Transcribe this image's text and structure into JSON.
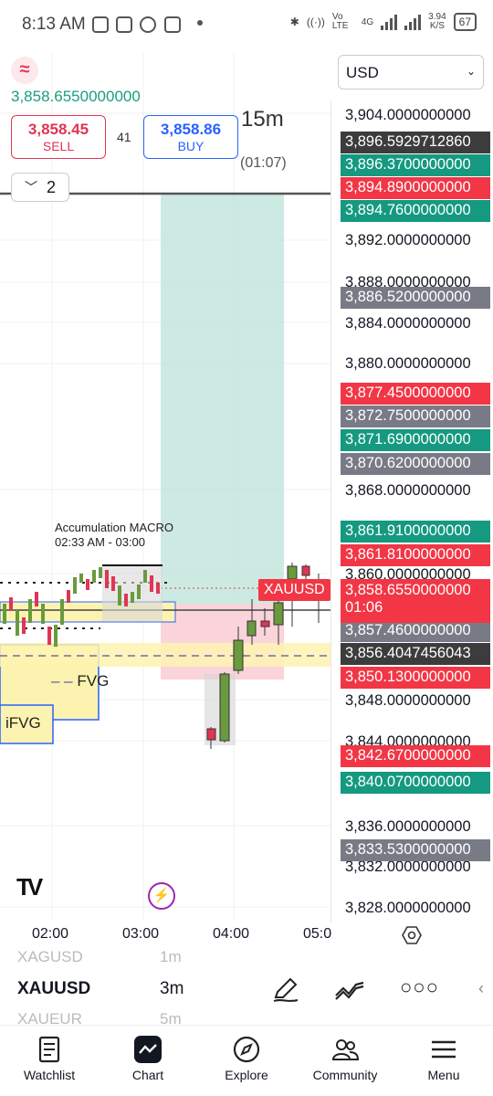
{
  "status_bar": {
    "time": "8:13 AM",
    "network_rate": "3.94",
    "network_rate_unit": "K/S",
    "battery": "67",
    "lte_label": "Vo LTE",
    "net_type": "4G"
  },
  "header": {
    "last_price": "3,858.6550000000",
    "sell_price": "3,858.45",
    "sell_label": "SELL",
    "buy_price": "3,858.86",
    "buy_label": "BUY",
    "spread": "41",
    "timeframe": "15m",
    "countdown": "(01:07)",
    "layers_count": "2"
  },
  "currency": {
    "selected": "USD"
  },
  "price_axis": {
    "ticks": [
      {
        "label": "3,904.0000000000"
      },
      {
        "label": "3,892.0000000000"
      },
      {
        "label": "3,888.0000000000"
      },
      {
        "label": "3,884.0000000000"
      },
      {
        "label": "3,880.0000000000"
      },
      {
        "label": "3,868.0000000000"
      },
      {
        "label": "3,860.0000000000"
      },
      {
        "label": "3,848.0000000000"
      },
      {
        "label": "3,844.0000000000"
      },
      {
        "label": "3,836.0000000000"
      },
      {
        "label": "3,832.0000000000"
      },
      {
        "label": "3,828.0000000000"
      }
    ],
    "labels": [
      {
        "text": "3,896.5929712860",
        "color": "#3c3c3c"
      },
      {
        "text": "3,896.3700000000",
        "color": "#159980"
      },
      {
        "text": "3,894.8900000000",
        "color": "#f23645"
      },
      {
        "text": "3,894.7600000000",
        "color": "#159980"
      },
      {
        "text": "3,886.5200000000",
        "color": "#787b86"
      },
      {
        "text": "3,877.4500000000",
        "color": "#f23645"
      },
      {
        "text": "3,872.7500000000",
        "color": "#787b86"
      },
      {
        "text": "3,871.6900000000",
        "color": "#159980"
      },
      {
        "text": "3,870.6200000000",
        "color": "#787b86"
      },
      {
        "text": "3,861.9100000000",
        "color": "#159980"
      },
      {
        "text": "3,861.8100000000",
        "color": "#f23645"
      },
      {
        "text": "3,857.4600000000",
        "color": "#787b86"
      },
      {
        "text": "3,856.4047456043",
        "color": "#3c3c3c"
      },
      {
        "text": "3,850.1300000000",
        "color": "#f23645"
      },
      {
        "text": "3,842.6700000000",
        "color": "#f23645"
      },
      {
        "text": "3,840.0700000000",
        "color": "#159980"
      },
      {
        "text": "3,833.5300000000",
        "color": "#787b86"
      }
    ],
    "current_price": "3,858.6550000000",
    "current_countdown": "01:06"
  },
  "chart": {
    "symbol_tag": "XAUUSD",
    "macro_title": "Accumulation MACRO",
    "macro_range": "02:33 AM - 03:00",
    "fvg_label": "FVG",
    "ifvg_label": "iFVG",
    "colors": {
      "up": "#6a9a3e",
      "down": "#e03553",
      "target": "#b7e1d6",
      "stop": "#f9cdd3",
      "fvg": "#fdf3b0"
    }
  },
  "time_axis": {
    "ticks": [
      "02:00",
      "03:00",
      "04:00",
      "05:0"
    ]
  },
  "symbol_strip": {
    "ghost_above": "XAGUSD",
    "ghost_above_interval": "1m",
    "symbol": "XAUUSD",
    "interval": "3m",
    "ghost_below": "XAUEUR",
    "ghost_below_interval": "5m"
  },
  "bottom_nav": [
    {
      "label": "Watchlist",
      "icon": "watchlist-icon"
    },
    {
      "label": "Chart",
      "icon": "chart-icon"
    },
    {
      "label": "Explore",
      "icon": "compass-icon"
    },
    {
      "label": "Community",
      "icon": "community-icon"
    },
    {
      "label": "Menu",
      "icon": "menu-icon"
    }
  ]
}
